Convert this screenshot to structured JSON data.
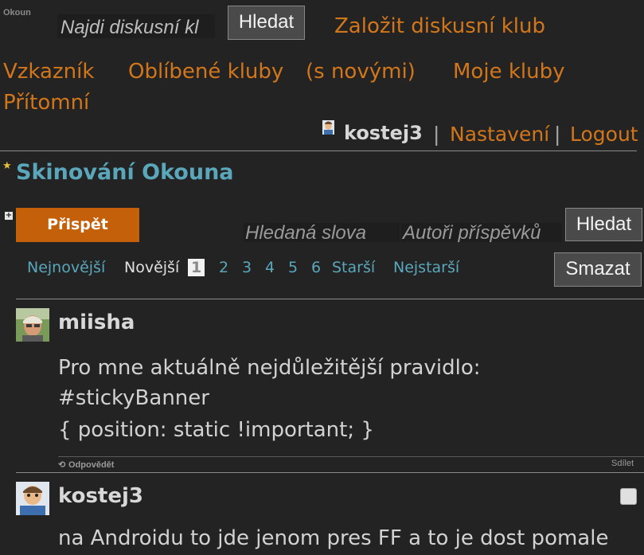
{
  "header": {
    "logo": "Okoun",
    "search_placeholder": "Najdi diskusní kl",
    "search_button": "Hledat",
    "create_club": "Založit diskusní klub"
  },
  "nav": {
    "messages": "Vzkazník",
    "favorites": "Oblíbené kluby",
    "favorites_new": "(s novými)",
    "my_clubs": "Moje kluby",
    "present": "Přítomní"
  },
  "user": {
    "name": "kostej3",
    "separator": "|",
    "settings": "Nastavení",
    "logout": "Logout"
  },
  "club": {
    "title": "Skinování Okouna",
    "star": "★",
    "expand": "+",
    "post_button": "Přispět",
    "search_words_placeholder": "Hledaná slova",
    "search_authors_placeholder": "Autoři příspěvků",
    "search_button": "Hledat",
    "delete_button": "Smazat"
  },
  "pager": {
    "newest": "Nejnovější",
    "newer": "Novější",
    "pages": [
      "1",
      "2",
      "3",
      "4",
      "5",
      "6"
    ],
    "current": "1",
    "older": "Starší",
    "oldest": "Nejstarší"
  },
  "posts": [
    {
      "author": "miisha",
      "lines": [
        "Pro mne aktuálně nejdůležitější pravidlo:",
        "#stickyBanner",
        "{ position: static !important; }"
      ],
      "reply": "Odpovědět",
      "share": "Sdílet",
      "reply_icon": "reply-icon"
    },
    {
      "author": "kostej3",
      "lines": [
        "na Androidu to jde jenom pres FF a to je dost pomale"
      ]
    }
  ]
}
